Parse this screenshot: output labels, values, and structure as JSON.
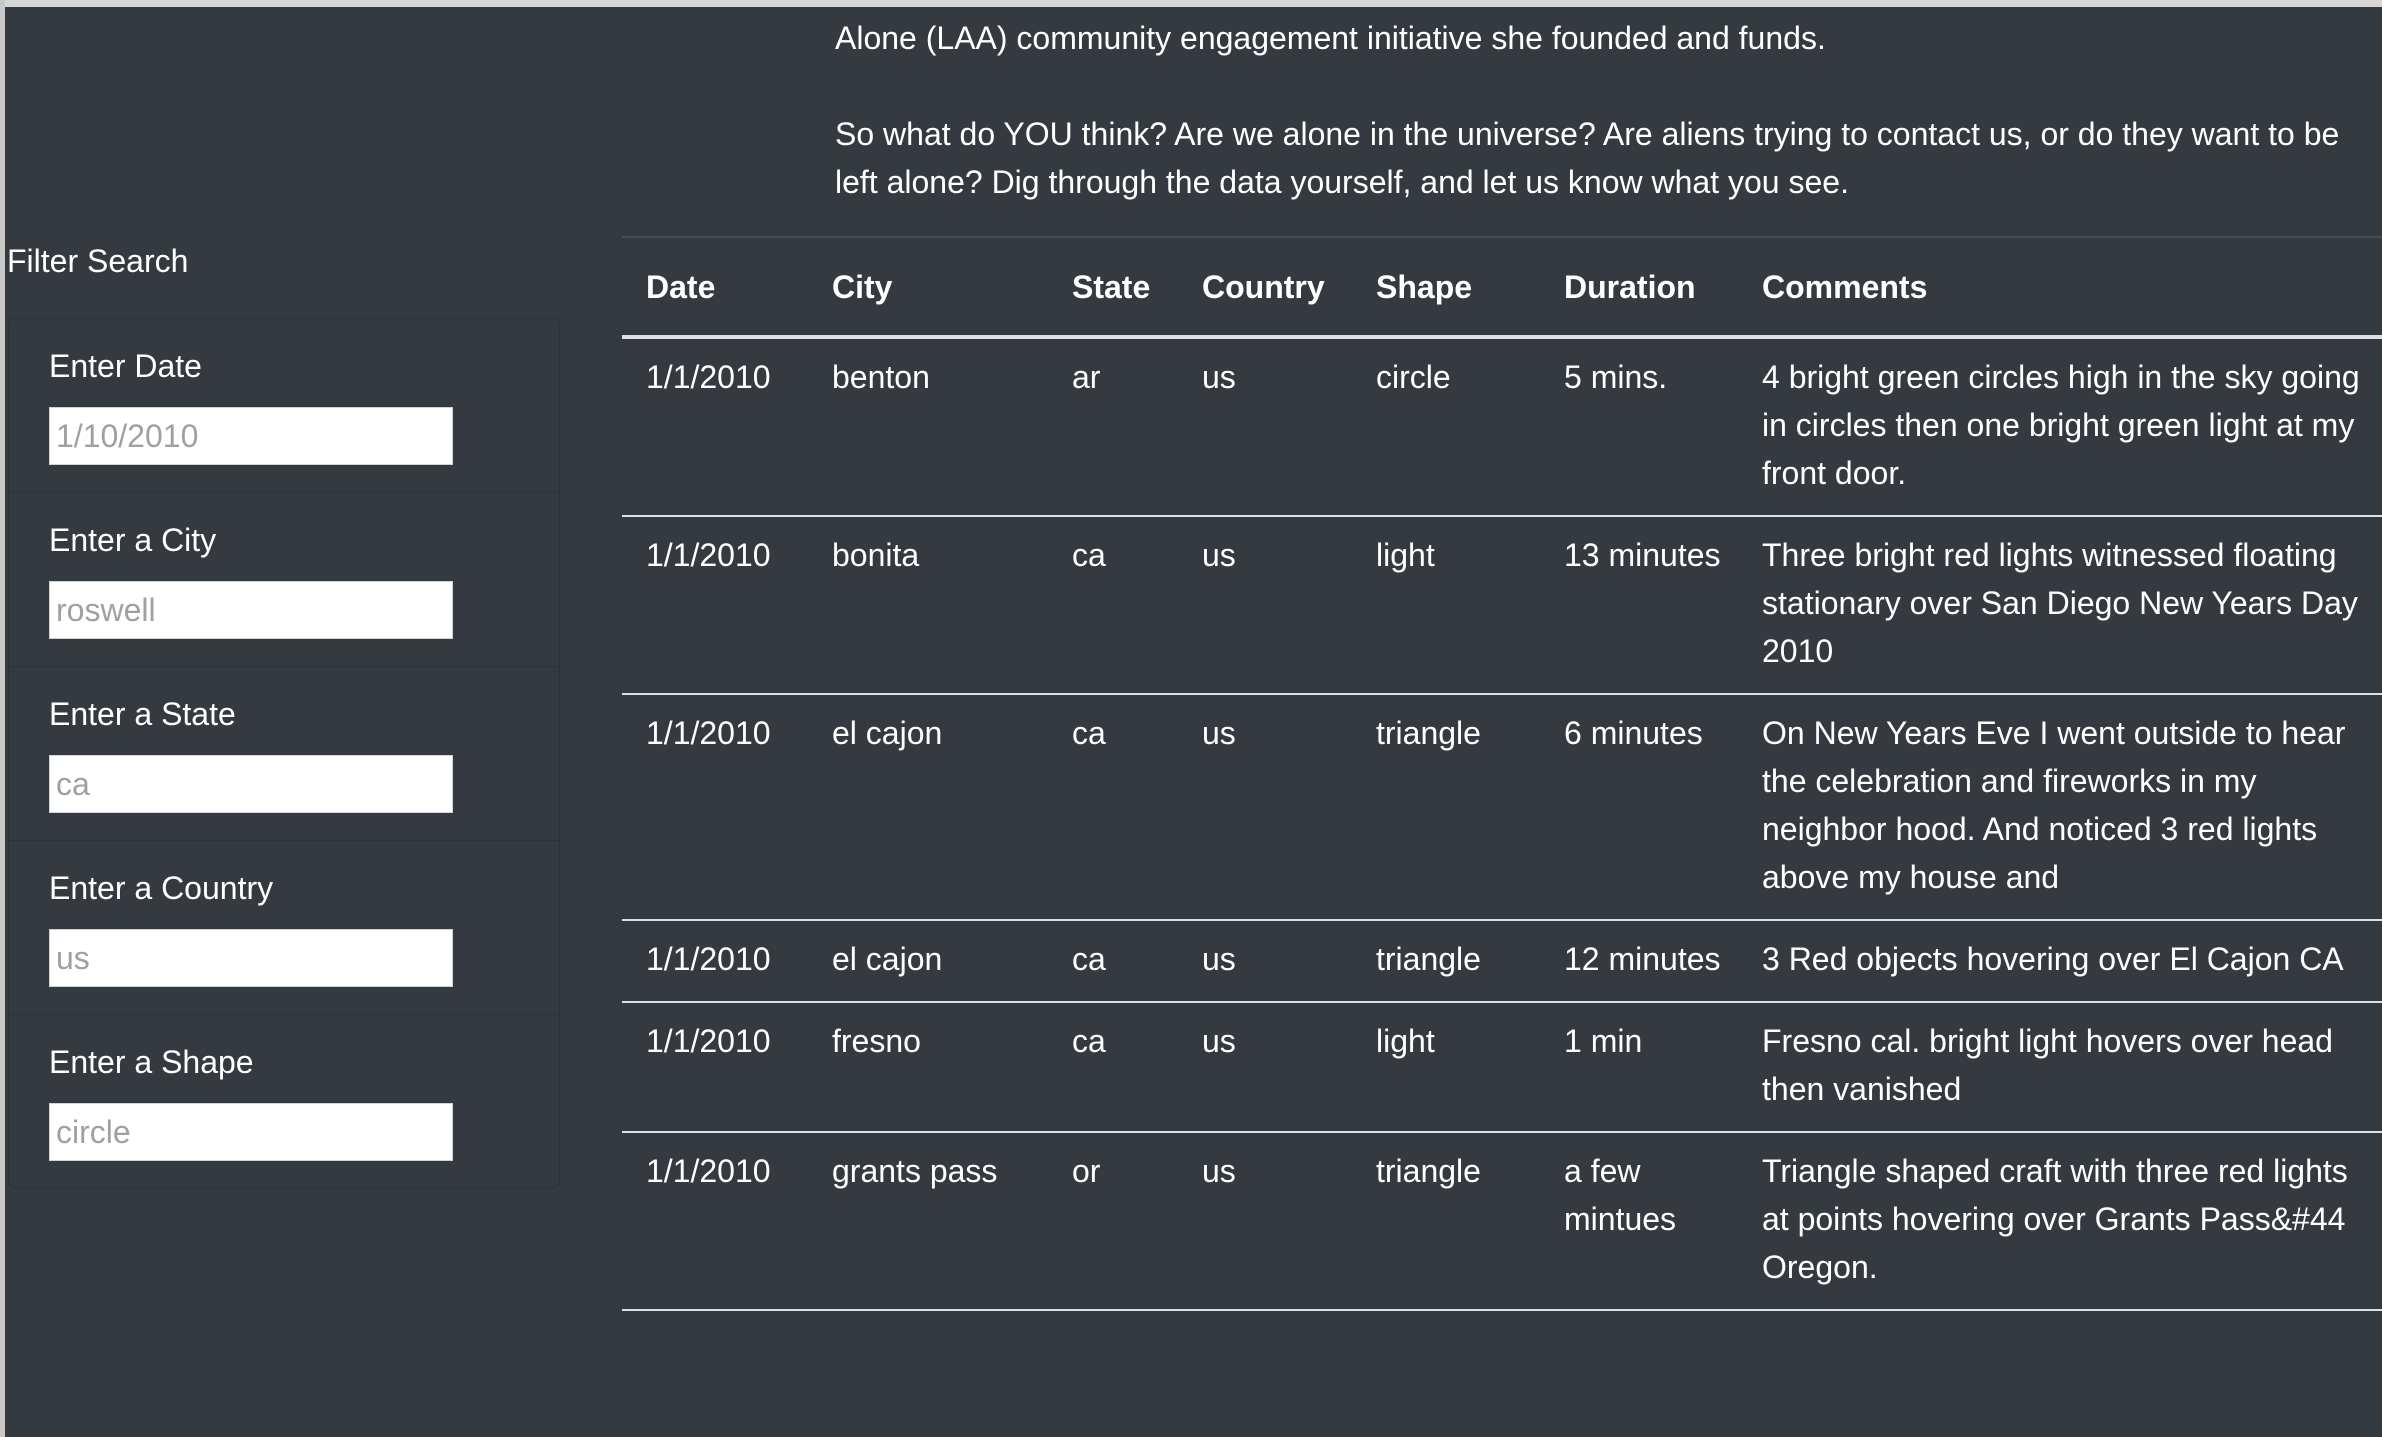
{
  "intro": {
    "line1": "Alone (LAA) community engagement initiative she founded and funds.",
    "line2": "So what do YOU think? Are we alone in the universe? Are aliens trying to contact us, or do they want to be left alone? Dig through the data yourself, and let us know what you see."
  },
  "sidebar": {
    "title": "Filter Search",
    "filters": [
      {
        "label": "Enter Date",
        "placeholder": "1/10/2010"
      },
      {
        "label": "Enter a City",
        "placeholder": "roswell"
      },
      {
        "label": "Enter a State",
        "placeholder": "ca"
      },
      {
        "label": "Enter a Country",
        "placeholder": "us"
      },
      {
        "label": "Enter a Shape",
        "placeholder": "circle"
      }
    ]
  },
  "table": {
    "headers": [
      "Date",
      "City",
      "State",
      "Country",
      "Shape",
      "Duration",
      "Comments"
    ],
    "rows": [
      [
        "1/1/2010",
        "benton",
        "ar",
        "us",
        "circle",
        "5 mins.",
        "4 bright green circles high in the sky going in circles then one bright green light at my front door."
      ],
      [
        "1/1/2010",
        "bonita",
        "ca",
        "us",
        "light",
        "13 minutes",
        "Three bright red lights witnessed floating stationary over San Diego New Years Day 2010"
      ],
      [
        "1/1/2010",
        "el cajon",
        "ca",
        "us",
        "triangle",
        "6 minutes",
        "On New Years Eve I went outside to hear the celebration and fireworks in my neighbor hood. And noticed 3 red lights above my house and"
      ],
      [
        "1/1/2010",
        "el cajon",
        "ca",
        "us",
        "triangle",
        "12 minutes",
        "3 Red objects hovering over El Cajon CA"
      ],
      [
        "1/1/2010",
        "fresno",
        "ca",
        "us",
        "light",
        "1 min",
        "Fresno cal. bright light hovers over head then vanished"
      ],
      [
        "1/1/2010",
        "grants pass",
        "or",
        "us",
        "triangle",
        "a few mintues",
        "Triangle shaped craft with three red lights at points hovering over Grants Pass&#44 Oregon."
      ]
    ]
  }
}
